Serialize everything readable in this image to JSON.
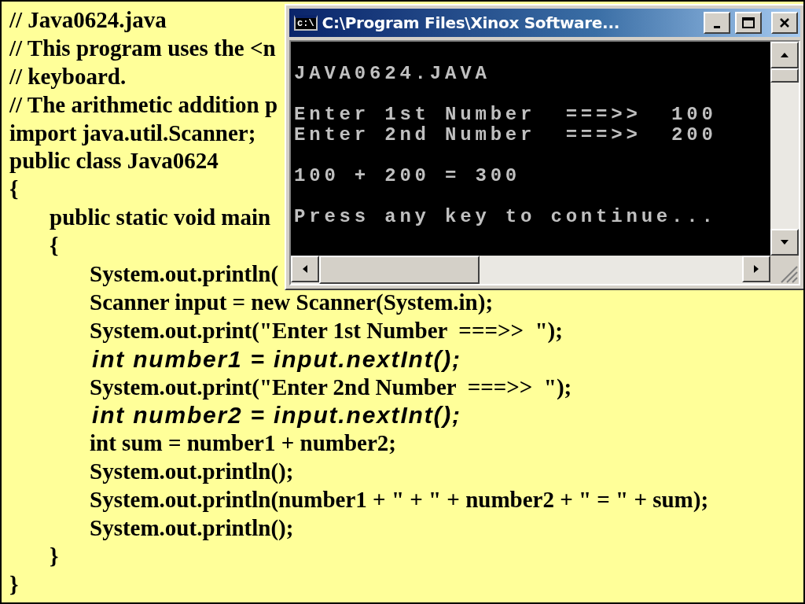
{
  "code": [
    {
      "text": "// Java0624.java",
      "kind": "plain"
    },
    {
      "text": "// This program uses the <n",
      "kind": "plain"
    },
    {
      "text": "// keyboard.",
      "kind": "plain"
    },
    {
      "text": "// The arithmetic addition p",
      "kind": "plain"
    },
    {
      "text": "import java.util.Scanner;",
      "kind": "plain"
    },
    {
      "text": "public class Java0624",
      "kind": "plain"
    },
    {
      "text": "{",
      "kind": "plain",
      "children": [
        {
          "text": "public static void main",
          "kind": "plain"
        },
        {
          "text": "{",
          "kind": "plain",
          "children": [
            {
              "text": "System.out.println(",
              "kind": "plain"
            },
            {
              "text": "Scanner input = new Scanner(System.in);",
              "kind": "plain"
            },
            {
              "text": "System.out.print(\"Enter 1st Number  ===>>  \");",
              "kind": "plain"
            },
            {
              "text": "int number1 = input.nextInt();",
              "kind": "highlight"
            },
            {
              "text": "System.out.print(\"Enter 2nd Number  ===>>  \");",
              "kind": "plain"
            },
            {
              "text": "int number2 = input.nextInt();",
              "kind": "highlight"
            },
            {
              "text": "int sum = number1 + number2;",
              "kind": "plain"
            },
            {
              "text": "System.out.println();",
              "kind": "plain"
            },
            {
              "text": "System.out.println(number1 + \" + \" + number2 + \" = \" + sum);",
              "kind": "plain"
            },
            {
              "text": "System.out.println();",
              "kind": "plain"
            }
          ]
        },
        {
          "text": "}",
          "kind": "plain"
        }
      ]
    },
    {
      "text": "}",
      "kind": "plain"
    }
  ],
  "console": {
    "title": "C:\\Program Files\\Xinox Software...",
    "icon_text": "c:\\",
    "blocks": [
      [
        "JAVA0624.JAVA"
      ],
      [
        "Enter 1st Number  ===>>  100",
        "Enter 2nd Number  ===>>  200"
      ],
      [
        "100 + 200 = 300"
      ],
      [
        "Press any key to continue..."
      ]
    ]
  }
}
